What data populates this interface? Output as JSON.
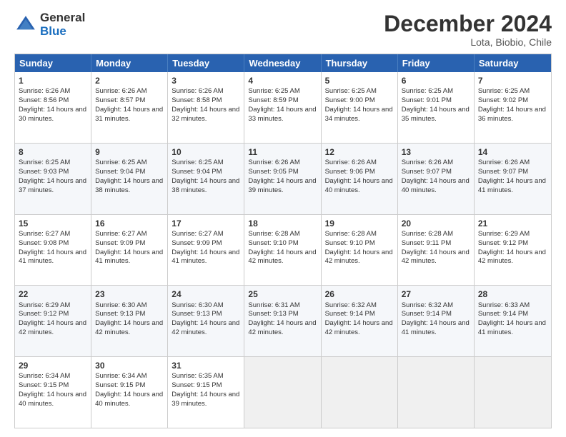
{
  "logo": {
    "general": "General",
    "blue": "Blue"
  },
  "header": {
    "title": "December 2024",
    "subtitle": "Lota, Biobio, Chile"
  },
  "days": [
    "Sunday",
    "Monday",
    "Tuesday",
    "Wednesday",
    "Thursday",
    "Friday",
    "Saturday"
  ],
  "weeks": [
    [
      {
        "day": "1",
        "sunrise": "Sunrise: 6:26 AM",
        "sunset": "Sunset: 8:56 PM",
        "daylight": "Daylight: 14 hours and 30 minutes."
      },
      {
        "day": "2",
        "sunrise": "Sunrise: 6:26 AM",
        "sunset": "Sunset: 8:57 PM",
        "daylight": "Daylight: 14 hours and 31 minutes."
      },
      {
        "day": "3",
        "sunrise": "Sunrise: 6:26 AM",
        "sunset": "Sunset: 8:58 PM",
        "daylight": "Daylight: 14 hours and 32 minutes."
      },
      {
        "day": "4",
        "sunrise": "Sunrise: 6:25 AM",
        "sunset": "Sunset: 8:59 PM",
        "daylight": "Daylight: 14 hours and 33 minutes."
      },
      {
        "day": "5",
        "sunrise": "Sunrise: 6:25 AM",
        "sunset": "Sunset: 9:00 PM",
        "daylight": "Daylight: 14 hours and 34 minutes."
      },
      {
        "day": "6",
        "sunrise": "Sunrise: 6:25 AM",
        "sunset": "Sunset: 9:01 PM",
        "daylight": "Daylight: 14 hours and 35 minutes."
      },
      {
        "day": "7",
        "sunrise": "Sunrise: 6:25 AM",
        "sunset": "Sunset: 9:02 PM",
        "daylight": "Daylight: 14 hours and 36 minutes."
      }
    ],
    [
      {
        "day": "8",
        "sunrise": "Sunrise: 6:25 AM",
        "sunset": "Sunset: 9:03 PM",
        "daylight": "Daylight: 14 hours and 37 minutes."
      },
      {
        "day": "9",
        "sunrise": "Sunrise: 6:25 AM",
        "sunset": "Sunset: 9:04 PM",
        "daylight": "Daylight: 14 hours and 38 minutes."
      },
      {
        "day": "10",
        "sunrise": "Sunrise: 6:25 AM",
        "sunset": "Sunset: 9:04 PM",
        "daylight": "Daylight: 14 hours and 38 minutes."
      },
      {
        "day": "11",
        "sunrise": "Sunrise: 6:26 AM",
        "sunset": "Sunset: 9:05 PM",
        "daylight": "Daylight: 14 hours and 39 minutes."
      },
      {
        "day": "12",
        "sunrise": "Sunrise: 6:26 AM",
        "sunset": "Sunset: 9:06 PM",
        "daylight": "Daylight: 14 hours and 40 minutes."
      },
      {
        "day": "13",
        "sunrise": "Sunrise: 6:26 AM",
        "sunset": "Sunset: 9:07 PM",
        "daylight": "Daylight: 14 hours and 40 minutes."
      },
      {
        "day": "14",
        "sunrise": "Sunrise: 6:26 AM",
        "sunset": "Sunset: 9:07 PM",
        "daylight": "Daylight: 14 hours and 41 minutes."
      }
    ],
    [
      {
        "day": "15",
        "sunrise": "Sunrise: 6:27 AM",
        "sunset": "Sunset: 9:08 PM",
        "daylight": "Daylight: 14 hours and 41 minutes."
      },
      {
        "day": "16",
        "sunrise": "Sunrise: 6:27 AM",
        "sunset": "Sunset: 9:09 PM",
        "daylight": "Daylight: 14 hours and 41 minutes."
      },
      {
        "day": "17",
        "sunrise": "Sunrise: 6:27 AM",
        "sunset": "Sunset: 9:09 PM",
        "daylight": "Daylight: 14 hours and 41 minutes."
      },
      {
        "day": "18",
        "sunrise": "Sunrise: 6:28 AM",
        "sunset": "Sunset: 9:10 PM",
        "daylight": "Daylight: 14 hours and 42 minutes."
      },
      {
        "day": "19",
        "sunrise": "Sunrise: 6:28 AM",
        "sunset": "Sunset: 9:10 PM",
        "daylight": "Daylight: 14 hours and 42 minutes."
      },
      {
        "day": "20",
        "sunrise": "Sunrise: 6:28 AM",
        "sunset": "Sunset: 9:11 PM",
        "daylight": "Daylight: 14 hours and 42 minutes."
      },
      {
        "day": "21",
        "sunrise": "Sunrise: 6:29 AM",
        "sunset": "Sunset: 9:12 PM",
        "daylight": "Daylight: 14 hours and 42 minutes."
      }
    ],
    [
      {
        "day": "22",
        "sunrise": "Sunrise: 6:29 AM",
        "sunset": "Sunset: 9:12 PM",
        "daylight": "Daylight: 14 hours and 42 minutes."
      },
      {
        "day": "23",
        "sunrise": "Sunrise: 6:30 AM",
        "sunset": "Sunset: 9:13 PM",
        "daylight": "Daylight: 14 hours and 42 minutes."
      },
      {
        "day": "24",
        "sunrise": "Sunrise: 6:30 AM",
        "sunset": "Sunset: 9:13 PM",
        "daylight": "Daylight: 14 hours and 42 minutes."
      },
      {
        "day": "25",
        "sunrise": "Sunrise: 6:31 AM",
        "sunset": "Sunset: 9:13 PM",
        "daylight": "Daylight: 14 hours and 42 minutes."
      },
      {
        "day": "26",
        "sunrise": "Sunrise: 6:32 AM",
        "sunset": "Sunset: 9:14 PM",
        "daylight": "Daylight: 14 hours and 42 minutes."
      },
      {
        "day": "27",
        "sunrise": "Sunrise: 6:32 AM",
        "sunset": "Sunset: 9:14 PM",
        "daylight": "Daylight: 14 hours and 41 minutes."
      },
      {
        "day": "28",
        "sunrise": "Sunrise: 6:33 AM",
        "sunset": "Sunset: 9:14 PM",
        "daylight": "Daylight: 14 hours and 41 minutes."
      }
    ],
    [
      {
        "day": "29",
        "sunrise": "Sunrise: 6:34 AM",
        "sunset": "Sunset: 9:15 PM",
        "daylight": "Daylight: 14 hours and 40 minutes."
      },
      {
        "day": "30",
        "sunrise": "Sunrise: 6:34 AM",
        "sunset": "Sunset: 9:15 PM",
        "daylight": "Daylight: 14 hours and 40 minutes."
      },
      {
        "day": "31",
        "sunrise": "Sunrise: 6:35 AM",
        "sunset": "Sunset: 9:15 PM",
        "daylight": "Daylight: 14 hours and 39 minutes."
      },
      null,
      null,
      null,
      null
    ]
  ]
}
